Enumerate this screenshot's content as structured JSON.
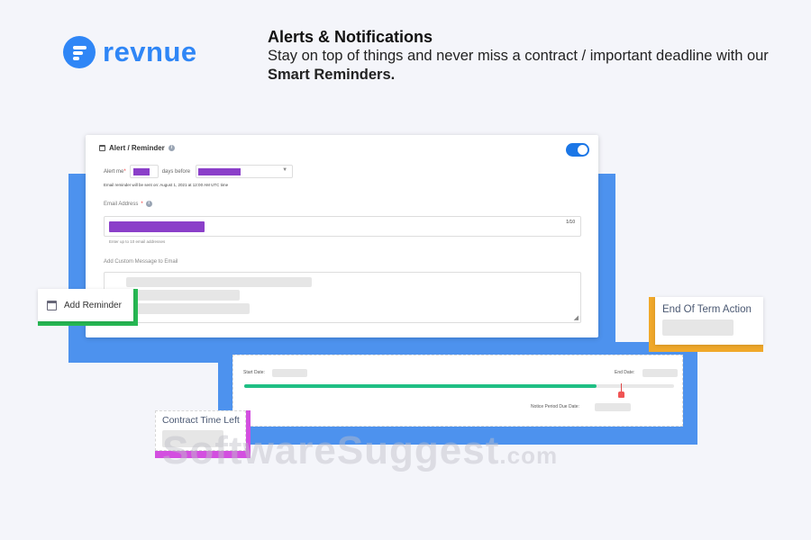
{
  "brand": {
    "name": "revnue",
    "color": "#2f86f6",
    "icon": "revnue-logo-icon"
  },
  "headline": {
    "title": "Alerts & Notifications",
    "desc_prefix": "Stay on top of things and never miss a contract / important deadline with our",
    "desc_bold": "Smart Reminders."
  },
  "reminder_card": {
    "title": "Alert / Reminder",
    "toggle_on": true,
    "alert_me_label": "Alert me",
    "days_before_label": "days before",
    "email_note": "Email reminder will be sent on: August 1, 2021 at 12:00 AM UTC time",
    "email_label": "Email Address",
    "email_count": "1/10",
    "email_hint": "Enter up to 10 email addresses",
    "message_label": "Add Custom Message to Email"
  },
  "add_reminder": {
    "label": "Add Reminder",
    "icon": "calendar-icon"
  },
  "end_of_term": {
    "label": "End Of Term Action"
  },
  "timeline": {
    "start_label": "Start Date:",
    "end_label": "End Date:",
    "notice_label": "Notice Period Due Date:",
    "progress_fraction": 0.82
  },
  "contract_time_left": {
    "label": "Contract Time Left"
  },
  "watermark": {
    "main": "SoftwareSuggest",
    "suffix": ".com"
  },
  "colors": {
    "accent_blue": "#4d92ee",
    "placeholder_purple": "#8b3fc9",
    "progress_green": "#1fbf84",
    "add_reminder_green": "#27b954",
    "eot_orange": "#f0a82a",
    "ctl_magenta": "#d34fe0",
    "marker_red": "#f05454"
  }
}
